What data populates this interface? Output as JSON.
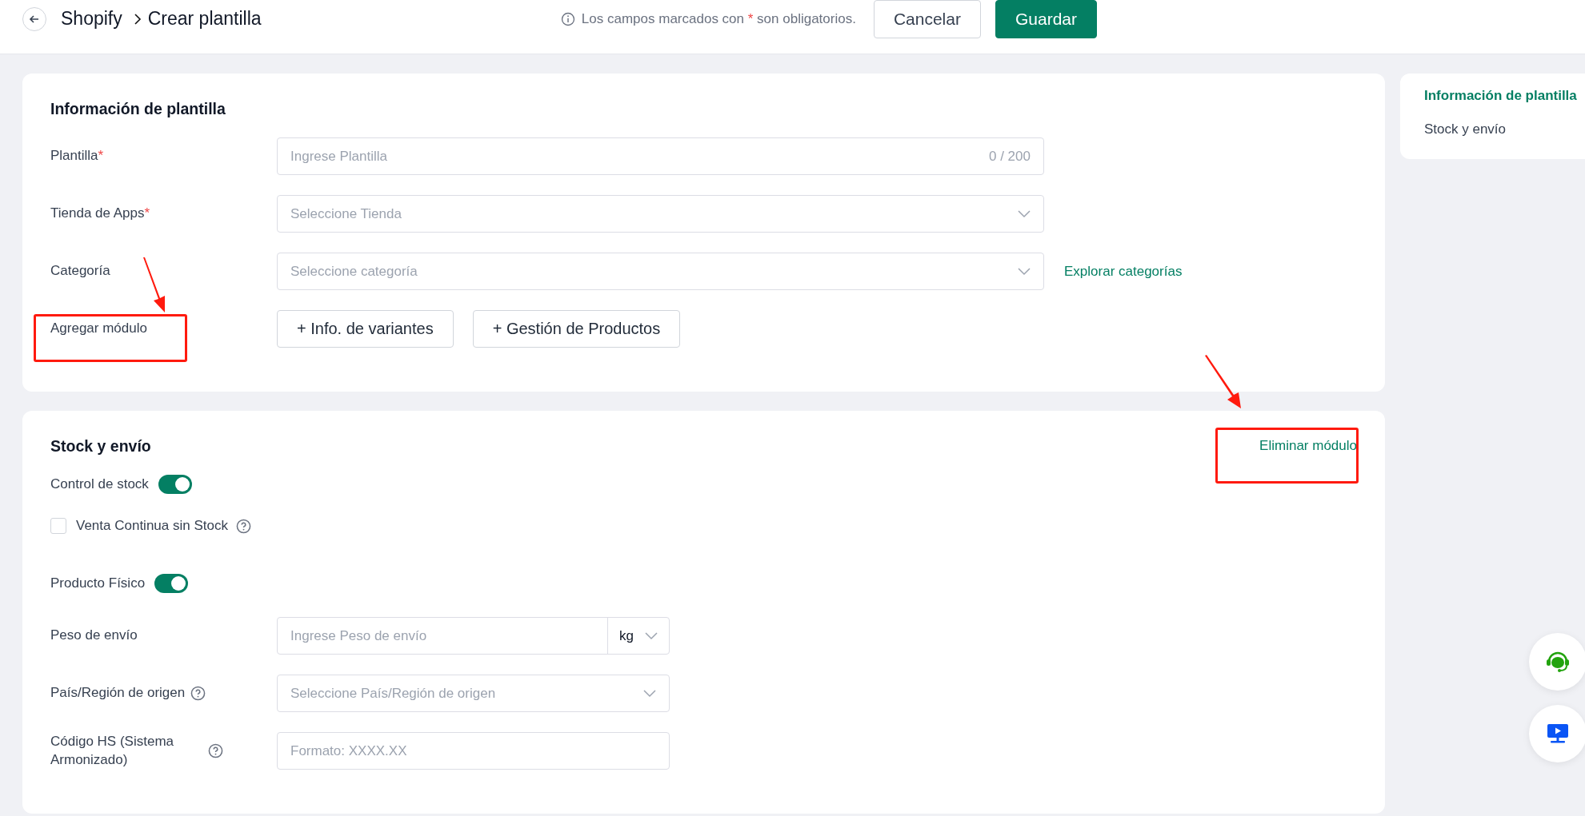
{
  "header": {
    "breadcrumb": [
      "Shopify",
      "Crear plantilla"
    ],
    "note": {
      "before": "Los campos marcados con ",
      "mark": "*",
      "after": " son obligatorios."
    },
    "buttons": [
      {
        "label": "Cancelar",
        "kind": "secondary"
      },
      {
        "label": "Guardar",
        "kind": "primary"
      }
    ]
  },
  "sections": [
    {
      "title": "Información de plantilla",
      "rows": [
        {
          "kind": "input",
          "label": "Plantilla",
          "required": true,
          "placeholder": "Ingrese Plantilla",
          "counter": "0 / 200"
        },
        {
          "kind": "select",
          "label": "Tienda de Apps",
          "required": true,
          "placeholder": "Seleccione Tienda"
        },
        {
          "kind": "select",
          "label": "Categoría",
          "required": false,
          "placeholder": "Seleccione categoría",
          "link": "Explorar categorías"
        },
        {
          "kind": "modules",
          "label": "Agregar módulo",
          "buttons": [
            "+ Info. de variantes",
            "+ Gestión de Productos"
          ]
        }
      ]
    },
    {
      "title": "Stock y envío",
      "action": "Eliminar módulo",
      "rows": [
        {
          "kind": "toggle",
          "label": "Control de stock",
          "on": true
        },
        {
          "kind": "checkbox",
          "label": "Venta Continua sin Stock",
          "checked": false,
          "help": true
        },
        {
          "kind": "toggle",
          "label": "Producto Físico",
          "on": true
        },
        {
          "kind": "unit",
          "label": "Peso de envío",
          "placeholder": "Ingrese Peso de envío",
          "unit": "kg"
        },
        {
          "kind": "select",
          "label": "País/Región de origen",
          "help": true,
          "placeholder": "Seleccione País/Región de origen",
          "short": true
        },
        {
          "kind": "input",
          "label": "Código HS (Sistema Armonizado)",
          "help": true,
          "placeholder": "Formato: XXXX.XX",
          "short": true
        }
      ]
    }
  ],
  "nav": [
    {
      "label": "Información de plantilla",
      "selected": true
    },
    {
      "label": "Stock y envío",
      "selected": false
    }
  ]
}
